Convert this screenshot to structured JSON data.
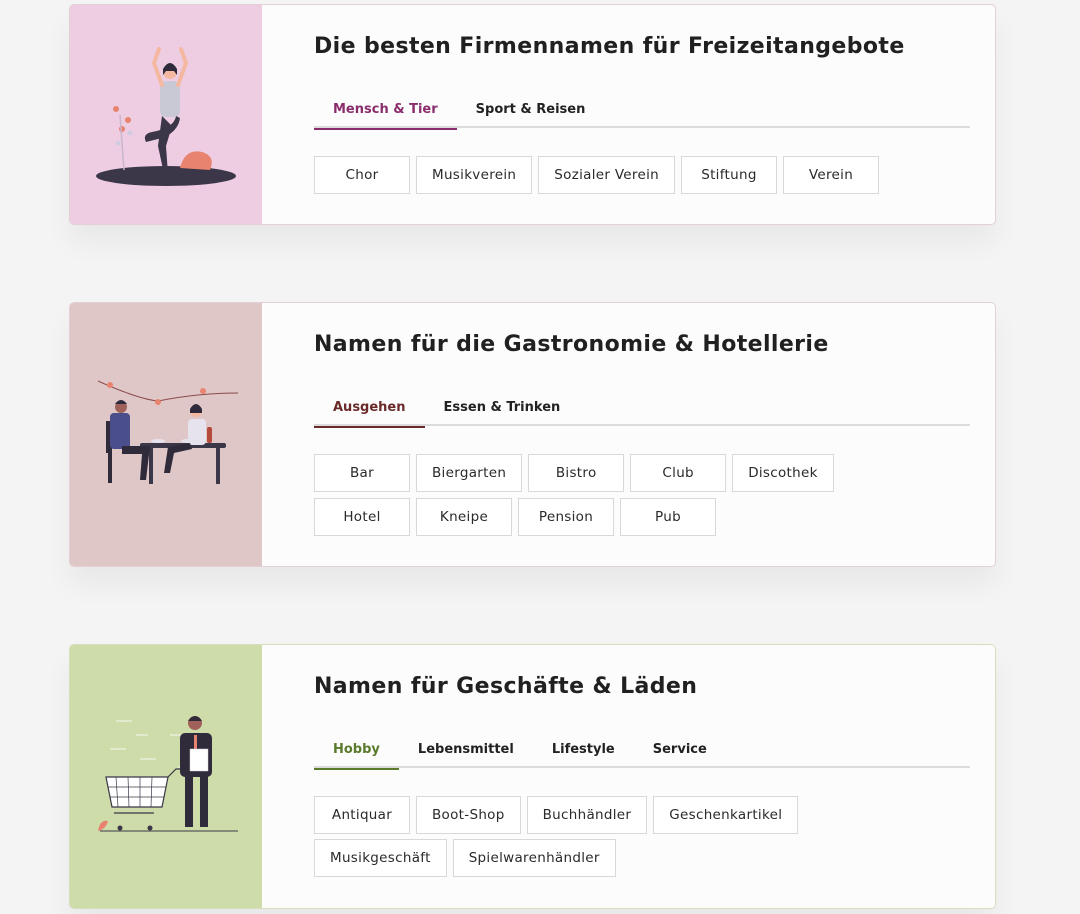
{
  "sections": [
    {
      "title": "Die besten Firmennamen für Freizeitangebote",
      "illustration": "yoga-woman-illustration",
      "bg": "#eecde3",
      "accent": "#8a2d6c",
      "tabs": [
        "Mensch & Tier",
        "Sport & Reisen"
      ],
      "active_tab": 0,
      "tags": [
        "Chor",
        "Musikverein",
        "Sozialer Verein",
        "Stiftung",
        "Verein"
      ]
    },
    {
      "title": "Namen für die Gastronomie & Hotellerie",
      "illustration": "dinner-couple-illustration",
      "bg": "#e0c7c7",
      "accent": "#6b2a2a",
      "tabs": [
        "Ausgehen",
        "Essen & Trinken"
      ],
      "active_tab": 0,
      "tags": [
        "Bar",
        "Biergarten",
        "Bistro",
        "Club",
        "Discothek",
        "Hotel",
        "Kneipe",
        "Pension",
        "Pub"
      ]
    },
    {
      "title": "Namen für Geschäfte & Läden",
      "illustration": "shopping-man-illustration",
      "bg": "#cddca9",
      "accent": "#5a7a2c",
      "tabs": [
        "Hobby",
        "Lebensmittel",
        "Lifestyle",
        "Service"
      ],
      "active_tab": 0,
      "tags": [
        "Antiquar",
        "Boot-Shop",
        "Buchhändler",
        "Geschenkartikel",
        "Musikgeschäft",
        "Spielwarenhändler"
      ]
    }
  ]
}
